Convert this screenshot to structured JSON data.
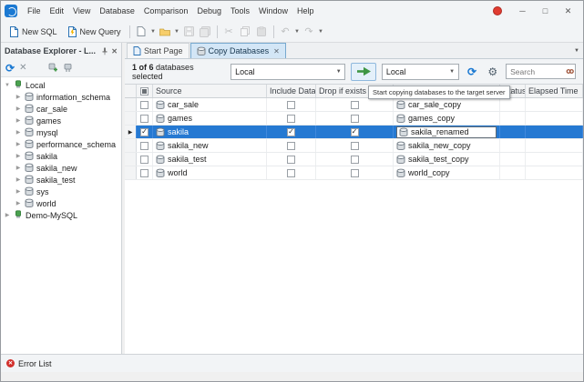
{
  "titlebar": {
    "menu_items": [
      "File",
      "Edit",
      "View",
      "Database",
      "Comparison",
      "Debug",
      "Tools",
      "Window",
      "Help"
    ]
  },
  "toolbar": {
    "new_sql_label": "New SQL",
    "new_query_label": "New Query"
  },
  "explorer": {
    "title": "Database Explorer - L...",
    "tree": [
      {
        "label": "Local",
        "level": 0,
        "icon": "server",
        "expander": "expanded"
      },
      {
        "label": "information_schema",
        "level": 1,
        "icon": "database",
        "expander": "collapsed"
      },
      {
        "label": "car_sale",
        "level": 1,
        "icon": "database",
        "expander": "collapsed"
      },
      {
        "label": "games",
        "level": 1,
        "icon": "database",
        "expander": "collapsed"
      },
      {
        "label": "mysql",
        "level": 1,
        "icon": "database",
        "expander": "collapsed"
      },
      {
        "label": "performance_schema",
        "level": 1,
        "icon": "database",
        "expander": "collapsed"
      },
      {
        "label": "sakila",
        "level": 1,
        "icon": "database",
        "expander": "collapsed"
      },
      {
        "label": "sakila_new",
        "level": 1,
        "icon": "database",
        "expander": "collapsed"
      },
      {
        "label": "sakila_test",
        "level": 1,
        "icon": "database",
        "expander": "collapsed"
      },
      {
        "label": "sys",
        "level": 1,
        "icon": "database",
        "expander": "collapsed"
      },
      {
        "label": "world",
        "level": 1,
        "icon": "database",
        "expander": "collapsed"
      },
      {
        "label": "Demo-MySQL",
        "level": 0,
        "icon": "server",
        "expander": "collapsed"
      }
    ]
  },
  "tabs": [
    {
      "label": "Start Page",
      "active": false,
      "closable": false
    },
    {
      "label": "Copy Databases",
      "active": true,
      "closable": true
    }
  ],
  "copy_panel": {
    "selection_count": "1 of 6",
    "selection_text": "databases selected",
    "source_server": "Local",
    "target_server": "Local",
    "search_placeholder": "Search"
  },
  "tooltip": {
    "text": "Start copying databases to the target server"
  },
  "grid": {
    "columns": [
      {
        "label": "",
        "name": "row-indicator",
        "width": 13
      },
      {
        "label": "",
        "name": "select-all",
        "width": 18
      },
      {
        "label": "Source",
        "name": "source",
        "width": 125
      },
      {
        "label": "Include Data",
        "name": "include-data",
        "width": 54
      },
      {
        "label": "Drop if exists on tar...",
        "name": "drop-if-exists",
        "width": 85
      },
      {
        "label": "",
        "name": "target",
        "width": 117
      },
      {
        "label": "Status",
        "name": "status",
        "width": 28
      },
      {
        "label": "Elapsed Time",
        "name": "elapsed-time",
        "width": 62
      }
    ],
    "rows": [
      {
        "selected": false,
        "checked": false,
        "source": "car_sale",
        "include_data": false,
        "drop_if_exists": false,
        "target": "car_sale_copy",
        "status": "",
        "elapsed": ""
      },
      {
        "selected": false,
        "checked": false,
        "source": "games",
        "include_data": false,
        "drop_if_exists": false,
        "target": "games_copy",
        "status": "",
        "elapsed": ""
      },
      {
        "selected": true,
        "checked": true,
        "source": "sakila",
        "include_data": true,
        "drop_if_exists": true,
        "target": "sakila_renamed",
        "status": "",
        "elapsed": "",
        "target_editing": true
      },
      {
        "selected": false,
        "checked": false,
        "source": "sakila_new",
        "include_data": false,
        "drop_if_exists": false,
        "target": "sakila_new_copy",
        "status": "",
        "elapsed": ""
      },
      {
        "selected": false,
        "checked": false,
        "source": "sakila_test",
        "include_data": false,
        "drop_if_exists": false,
        "target": "sakila_test_copy",
        "status": "",
        "elapsed": ""
      },
      {
        "selected": false,
        "checked": false,
        "source": "world",
        "include_data": false,
        "drop_if_exists": false,
        "target": "world_copy",
        "status": "",
        "elapsed": ""
      }
    ]
  },
  "statusbar": {
    "error_list_label": "Error List"
  },
  "icons": [
    "app-icon",
    "alert-icon",
    "minimize-icon",
    "maximize-icon",
    "close-icon",
    "new-sql-icon",
    "new-query-icon",
    "new-file-icon",
    "open-folder-icon",
    "save-icon",
    "save-all-icon",
    "cut-icon",
    "copy-icon",
    "paste-icon",
    "undo-icon",
    "redo-icon",
    "pin-icon",
    "refresh-icon",
    "disconnect-icon",
    "new-connection-icon",
    "connection-icon",
    "database-icon",
    "server-icon",
    "run-icon",
    "gear-icon",
    "search-icon",
    "error-icon"
  ]
}
